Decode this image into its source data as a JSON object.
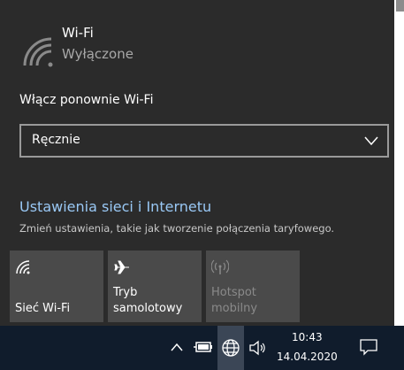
{
  "wifi": {
    "title": "Wi-Fi",
    "status": "Wyłączone",
    "reenable_label": "Włącz ponownie Wi-Fi",
    "reenable_selected": "Ręcznie"
  },
  "settings": {
    "link": "Ustawienia sieci i Internetu",
    "description": "Zmień ustawienia, takie jak tworzenie połączenia taryfowego."
  },
  "tiles": [
    {
      "label": "Sieć Wi-Fi",
      "icon": "wifi-icon",
      "enabled": true
    },
    {
      "label_line1": "Tryb",
      "label_line2": "samolotowy",
      "icon": "airplane-icon",
      "enabled": true
    },
    {
      "label_line1": "Hotspot",
      "label_line2": "mobilny",
      "icon": "hotspot-icon",
      "enabled": false
    }
  ],
  "taskbar": {
    "time": "10:43",
    "date": "14.04.2020"
  },
  "colors": {
    "flyout_bg": "#2b2b2b",
    "tile_bg": "#4a4a4a",
    "link": "#99c8f5",
    "taskbar_bg": "#101c2c"
  }
}
